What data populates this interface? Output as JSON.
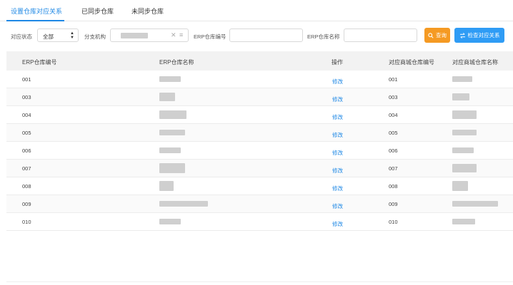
{
  "tabs": [
    {
      "label": "设置仓库对应关系",
      "active": true
    },
    {
      "label": "已同步仓库",
      "active": false
    },
    {
      "label": "未同步仓库",
      "active": false
    }
  ],
  "filters": {
    "status_label": "对应状态",
    "status_value": "全部",
    "org_label": "分支机构",
    "erp_code_label": "ERP仓库编号",
    "erp_code_value": "",
    "erp_name_label": "ERP仓库名称",
    "erp_name_value": "",
    "query_button": "查询",
    "check_button": "检查对应关系"
  },
  "table": {
    "columns": [
      "ERP仓库编号",
      "ERP仓库名称",
      "操作",
      "对应商城仓库编号",
      "对应商城仓库名称"
    ],
    "rows": [
      {
        "erp_code": "001",
        "action": "修改",
        "mall_code": "001"
      },
      {
        "erp_code": "003",
        "action": "修改",
        "mall_code": "003"
      },
      {
        "erp_code": "004",
        "action": "修改",
        "mall_code": "004"
      },
      {
        "erp_code": "005",
        "action": "修改",
        "mall_code": "005"
      },
      {
        "erp_code": "006",
        "action": "修改",
        "mall_code": "006"
      },
      {
        "erp_code": "007",
        "action": "修改",
        "mall_code": "007"
      },
      {
        "erp_code": "008",
        "action": "修改",
        "mall_code": "008"
      },
      {
        "erp_code": "009",
        "action": "修改",
        "mall_code": "009"
      },
      {
        "erp_code": "010",
        "action": "修改",
        "mall_code": "010"
      }
    ]
  },
  "colors": {
    "accent": "#1e88e5",
    "query": "#f59a23",
    "check": "#2f9cf5"
  }
}
